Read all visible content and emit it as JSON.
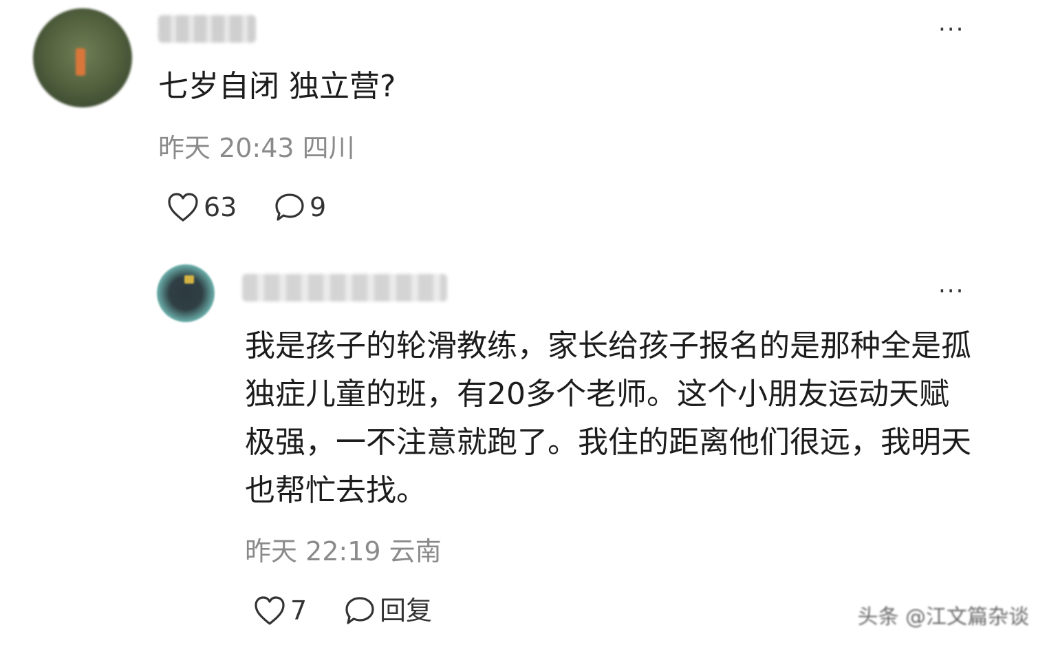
{
  "comment": {
    "username": "JIHEJU",
    "text": "七岁自闭 独立营?",
    "meta": "昨天 20:43 四川",
    "likes": "63",
    "replies": "9",
    "more": "···"
  },
  "reply": {
    "username": "小鹿轮滑教练",
    "text": "我是孩子的轮滑教练，家长给孩子报名的是那种全是孤独症儿童的班，有20多个老师。这个小朋友运动天赋极强，一不注意就跑了。我住的距离他们很远，我明天也帮忙去找。",
    "meta": "昨天 22:19 云南",
    "likes": "7",
    "reply_label": "回复",
    "more": "···"
  },
  "watermark": "头条 @江文篇杂谈",
  "icons": {
    "like": "heart-outline-icon",
    "comment": "speech-bubble-icon",
    "more": "more-dots-icon"
  }
}
